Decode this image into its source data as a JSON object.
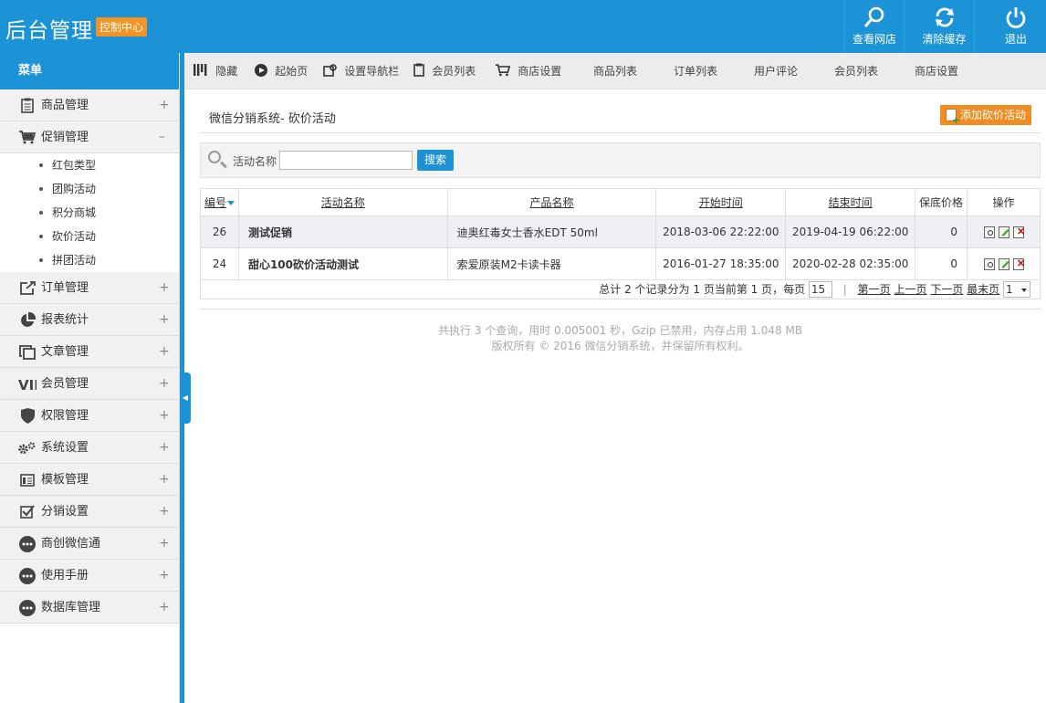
{
  "header": {
    "logo": "后台管理",
    "badge": "控制中心",
    "buttons": [
      {
        "label": "查看网店",
        "icon": "search-icon"
      },
      {
        "label": "清除缓存",
        "icon": "refresh-icon"
      },
      {
        "label": "退出",
        "icon": "power-icon"
      }
    ]
  },
  "sidebar": {
    "title": "菜单",
    "items": [
      {
        "label": "商品管理",
        "icon": "clipboard-icon",
        "toggle": "+"
      },
      {
        "label": "促销管理",
        "icon": "cart-icon",
        "toggle": "–"
      },
      {
        "label": "订单管理",
        "icon": "external-link-icon",
        "toggle": "+"
      },
      {
        "label": "报表统计",
        "icon": "pie-chart-icon",
        "toggle": "+"
      },
      {
        "label": "文章管理",
        "icon": "documents-icon",
        "toggle": "+"
      },
      {
        "label": "会员管理",
        "icon": "vip-icon",
        "toggle": "+"
      },
      {
        "label": "权限管理",
        "icon": "shield-icon",
        "toggle": "+"
      },
      {
        "label": "系统设置",
        "icon": "gears-icon",
        "toggle": "+"
      },
      {
        "label": "模板管理",
        "icon": "template-icon",
        "toggle": "+"
      },
      {
        "label": "分销设置",
        "icon": "checkbox-icon",
        "toggle": "+"
      },
      {
        "label": "商创微信通",
        "icon": "chat-dots-icon",
        "toggle": "+"
      },
      {
        "label": "使用手册",
        "icon": "chat-dots-icon",
        "toggle": "+"
      },
      {
        "label": "数据库管理",
        "icon": "chat-dots-icon",
        "toggle": "+"
      }
    ],
    "sub_items": [
      "红包类型",
      "团购活动",
      "积分商城",
      "砍价活动",
      "拼团活动"
    ]
  },
  "navbar": {
    "items": [
      {
        "label": "隐藏",
        "icon": "bars-icon"
      },
      {
        "label": "起始页",
        "icon": "play-icon"
      },
      {
        "label": "设置导航栏",
        "icon": "settings-box-icon"
      },
      {
        "label": "会员列表",
        "icon": "clipboard-icon"
      },
      {
        "label": "商店设置",
        "icon": "cart-icon"
      },
      {
        "label": "商品列表",
        "icon": ""
      },
      {
        "label": "订单列表",
        "icon": ""
      },
      {
        "label": "用户评论",
        "icon": ""
      },
      {
        "label": "会员列表",
        "icon": ""
      },
      {
        "label": "商店设置",
        "icon": ""
      }
    ]
  },
  "page": {
    "title": "微信分销系统- 砍价活动",
    "add_button": "添加砍价活动"
  },
  "search": {
    "label": "活动名称",
    "value": "",
    "button": "搜索"
  },
  "table": {
    "columns": [
      "编号",
      "活动名称",
      "产品名称",
      "开始时间",
      "结束时间",
      "保底价格",
      "操作"
    ],
    "rows": [
      {
        "id": "26",
        "name": "测试促销",
        "product": "迪奥红毒女士香水EDT 50ml",
        "start": "2018-03-06 22:22:00",
        "end": "2019-04-19 06:22:00",
        "price": "0"
      },
      {
        "id": "24",
        "name": "甜心100砍价活动测试",
        "product": "索爱原装M2卡读卡器",
        "start": "2016-01-27 18:35:00",
        "end": "2020-02-28 02:35:00",
        "price": "0"
      }
    ]
  },
  "pager": {
    "summary": "总计 2 个记录分为 1 页当前第 1 页，每页",
    "per_page": "15",
    "first": "第一页",
    "prev": "上一页",
    "next": "下一页",
    "last": "最末页",
    "page_select": "1"
  },
  "footer": {
    "line1": "共执行 3 个查询，用时 0.005001 秒，Gzip 已禁用，内存占用 1.048 MB",
    "line2": "版权所有 © 2016 微信分销系统，并保留所有权利。"
  },
  "colors": {
    "primary": "#1b93d6",
    "accent": "#f08c24"
  }
}
